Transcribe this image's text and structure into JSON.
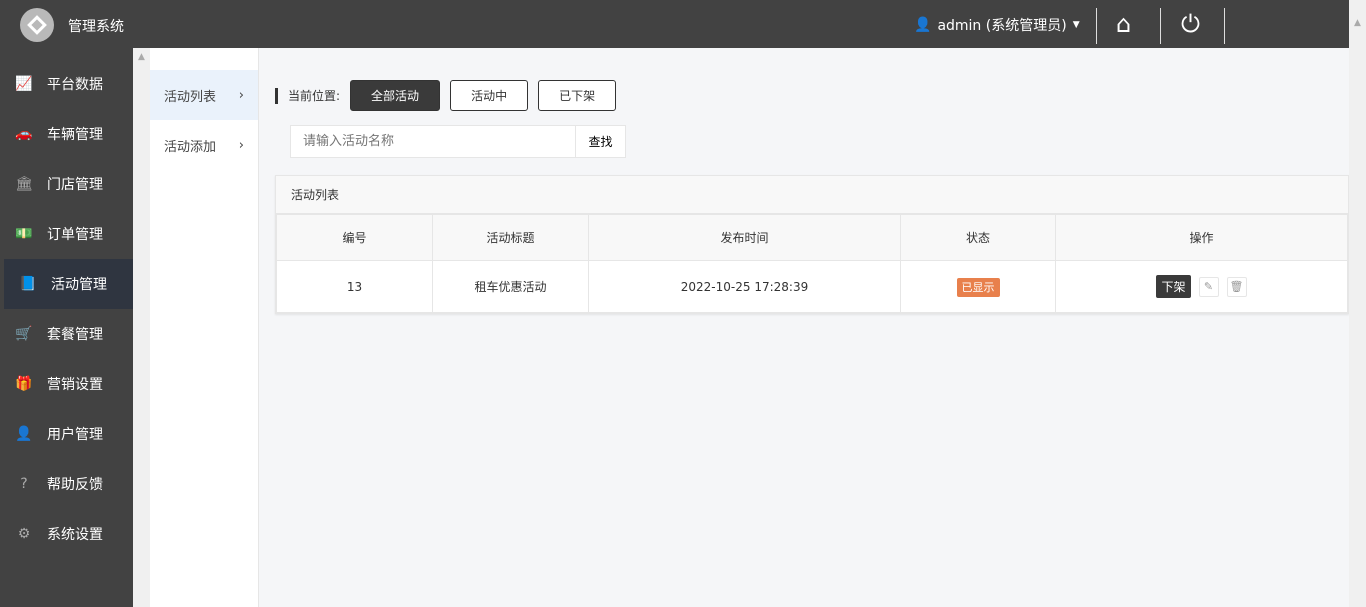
{
  "header": {
    "title": "管理系统",
    "user": "admin (系统管理员)"
  },
  "sidebar": {
    "items": [
      {
        "label": "平台数据",
        "icon": "chart-line-icon",
        "glyph": "📈"
      },
      {
        "label": "车辆管理",
        "icon": "car-icon",
        "glyph": "🚗"
      },
      {
        "label": "门店管理",
        "icon": "bank-icon",
        "glyph": "🏛"
      },
      {
        "label": "订单管理",
        "icon": "money-icon",
        "glyph": "💵"
      },
      {
        "label": "活动管理",
        "icon": "book-icon",
        "glyph": "📘"
      },
      {
        "label": "套餐管理",
        "icon": "cart-icon",
        "glyph": "🛒"
      },
      {
        "label": "营销设置",
        "icon": "gift-icon",
        "glyph": "🎁"
      },
      {
        "label": "用户管理",
        "icon": "user-icon",
        "glyph": "👤"
      },
      {
        "label": "帮助反馈",
        "icon": "question-icon",
        "glyph": "?"
      },
      {
        "label": "系统设置",
        "icon": "gear-icon",
        "glyph": "⚙"
      }
    ]
  },
  "submenu": [
    {
      "label": "活动列表"
    },
    {
      "label": "活动添加"
    }
  ],
  "breadcrumb": {
    "label": "当前位置:",
    "filters": [
      "全部活动",
      "活动中",
      "已下架"
    ]
  },
  "search": {
    "placeholder": "请输入活动名称",
    "button": "查找"
  },
  "panel": {
    "title": "活动列表"
  },
  "table": {
    "headers": [
      "编号",
      "活动标题",
      "发布时间",
      "状态",
      "操作"
    ],
    "rows": [
      {
        "id": "13",
        "title": "租车优惠活动",
        "time": "2022-10-25 17:28:39",
        "status": "已显示",
        "action": "下架"
      }
    ]
  },
  "colors": {
    "header": "#424242",
    "badge": "#e8804c"
  }
}
